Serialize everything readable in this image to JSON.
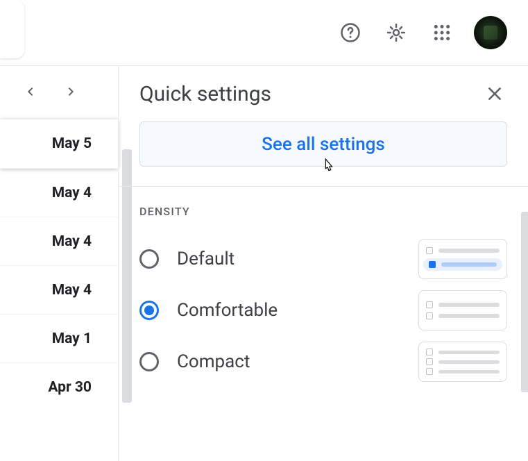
{
  "dates": [
    "May 5",
    "May 4",
    "May 4",
    "May 4",
    "May 1",
    "Apr 30"
  ],
  "activeDateIndex": 0,
  "panel": {
    "title": "Quick settings",
    "see_all": "See all settings",
    "density_label": "DENSITY",
    "options": [
      {
        "label": "Default",
        "selected": false
      },
      {
        "label": "Comfortable",
        "selected": true
      },
      {
        "label": "Compact",
        "selected": false
      }
    ]
  }
}
